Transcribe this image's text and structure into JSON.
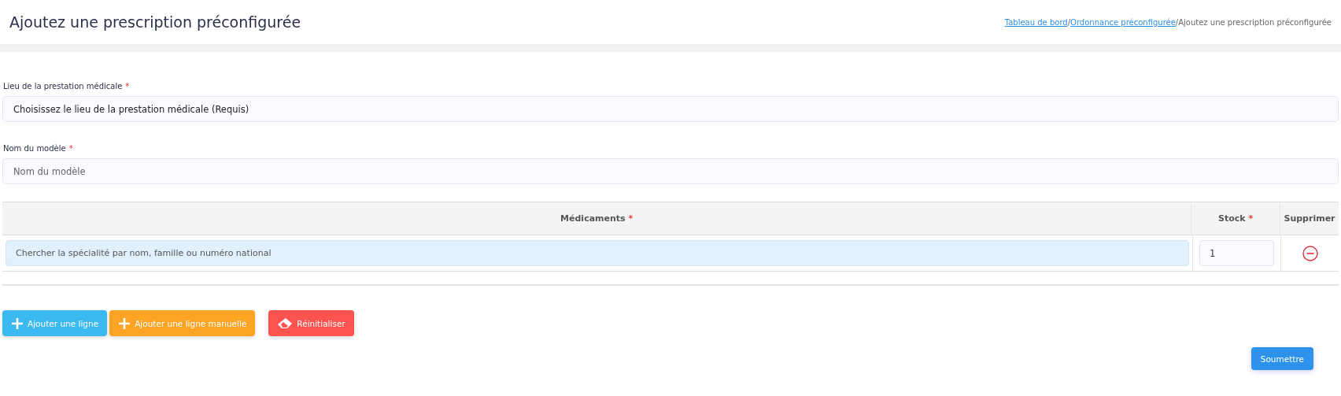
{
  "header": {
    "title": "Ajoutez une prescription préconfigurée",
    "breadcrumb": [
      {
        "label": "Tableau de bord",
        "kind": "link"
      },
      {
        "label": "Ordonnance préconfigurée",
        "kind": "link"
      },
      {
        "label": "Ajoutez une prescription préconfigurée",
        "kind": "current"
      }
    ],
    "separator": "/"
  },
  "fields": [
    {
      "label": "Lieu de la prestation médicale",
      "required": "*",
      "value": "Choisissez le lieu de la prestation médicale (Requis)"
    },
    {
      "label": "Nom du modèle",
      "required": "*",
      "placeholder": "Nom du modèle"
    }
  ],
  "table": {
    "columns": [
      {
        "label": "Médicaments",
        "required": "*"
      },
      {
        "label": "Stock",
        "required": "*"
      },
      {
        "label": "Supprimer"
      }
    ],
    "rows": [
      {
        "search_placeholder": "Chercher la spécialité par nom, famille ou numéro national",
        "stock": "1"
      }
    ]
  },
  "buttons": [
    {
      "label": "Ajouter une ligne",
      "kind": "add"
    },
    {
      "label": "Ajouter une ligne manuelle",
      "kind": "add-manual"
    },
    {
      "label": "Réinitialiser",
      "kind": "reset"
    }
  ],
  "submit": "Soumettre"
}
